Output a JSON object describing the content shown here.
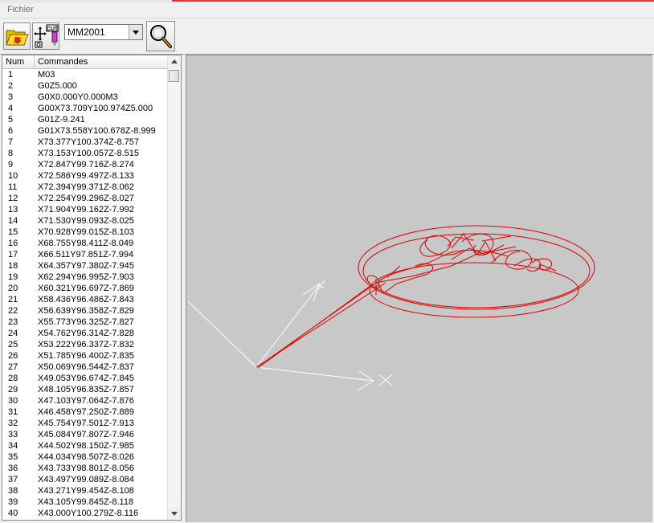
{
  "menu": {
    "file": "Fichier"
  },
  "toolbar": {
    "open_icon": "folder-open-icon",
    "tool_icon": "cut-tool-icon",
    "tool_badge": "CUT",
    "machine_select": "MM2001",
    "zoom_icon": "magnifier-zoom-icon"
  },
  "list": {
    "headers": {
      "num": "Num",
      "commands": "Commandes"
    },
    "rows": [
      {
        "num": "1",
        "cmd": "M03"
      },
      {
        "num": "2",
        "cmd": "G0Z5.000"
      },
      {
        "num": "3",
        "cmd": "G0X0.000Y0.000M3"
      },
      {
        "num": "4",
        "cmd": "G00X73.709Y100.974Z5.000"
      },
      {
        "num": "5",
        "cmd": "G01Z-9.241"
      },
      {
        "num": "6",
        "cmd": "G01X73.558Y100.678Z-8.999"
      },
      {
        "num": "7",
        "cmd": "X73.377Y100.374Z-8.757"
      },
      {
        "num": "8",
        "cmd": "X73.153Y100.057Z-8.515"
      },
      {
        "num": "9",
        "cmd": "X72.847Y99.716Z-8.274"
      },
      {
        "num": "10",
        "cmd": "X72.586Y99.497Z-8.133"
      },
      {
        "num": "11",
        "cmd": "X72.394Y99.371Z-8.062"
      },
      {
        "num": "12",
        "cmd": "X72.254Y99.296Z-8.027"
      },
      {
        "num": "13",
        "cmd": "X71.904Y99.162Z-7.992"
      },
      {
        "num": "14",
        "cmd": "X71.530Y99.093Z-8.025"
      },
      {
        "num": "15",
        "cmd": "X70.928Y99.015Z-8.103"
      },
      {
        "num": "16",
        "cmd": "X68.755Y98.411Z-8.049"
      },
      {
        "num": "17",
        "cmd": "X66.511Y97.851Z-7.994"
      },
      {
        "num": "18",
        "cmd": "X64.357Y97.380Z-7.945"
      },
      {
        "num": "19",
        "cmd": "X62.294Y96.995Z-7.903"
      },
      {
        "num": "20",
        "cmd": "X60.321Y96.697Z-7.869"
      },
      {
        "num": "21",
        "cmd": "X58.436Y96.486Z-7.843"
      },
      {
        "num": "22",
        "cmd": "X56.639Y96.358Z-7.829"
      },
      {
        "num": "23",
        "cmd": "X55.773Y96.325Z-7.827"
      },
      {
        "num": "24",
        "cmd": "X54.762Y96.314Z-7.828"
      },
      {
        "num": "25",
        "cmd": "X53.222Y96.337Z-7.832"
      },
      {
        "num": "26",
        "cmd": "X51.785Y96.400Z-7.835"
      },
      {
        "num": "27",
        "cmd": "X50.069Y96.544Z-7.837"
      },
      {
        "num": "28",
        "cmd": "X49.053Y96.674Z-7.845"
      },
      {
        "num": "29",
        "cmd": "X48.105Y96.835Z-7.857"
      },
      {
        "num": "30",
        "cmd": "X47.103Y97.064Z-7.876"
      },
      {
        "num": "31",
        "cmd": "X46.458Y97.250Z-7.889"
      },
      {
        "num": "32",
        "cmd": "X45.754Y97.501Z-7.913"
      },
      {
        "num": "33",
        "cmd": "X45.084Y97.807Z-7.946"
      },
      {
        "num": "34",
        "cmd": "X44.502Y98.150Z-7.985"
      },
      {
        "num": "35",
        "cmd": "X44.034Y98.507Z-8.026"
      },
      {
        "num": "36",
        "cmd": "X43.733Y98.801Z-8.056"
      },
      {
        "num": "37",
        "cmd": "X43.497Y99.089Z-8.084"
      },
      {
        "num": "38",
        "cmd": "X43.271Y99.454Z-8.108"
      },
      {
        "num": "39",
        "cmd": "X43.105Y99.845Z-8.118"
      },
      {
        "num": "40",
        "cmd": "X43.000Y100.279Z-8.116"
      }
    ]
  },
  "viewport": {
    "axis_color": "#ffffff",
    "toolpath_color": "#e00000",
    "background": "#c8c8c8"
  }
}
